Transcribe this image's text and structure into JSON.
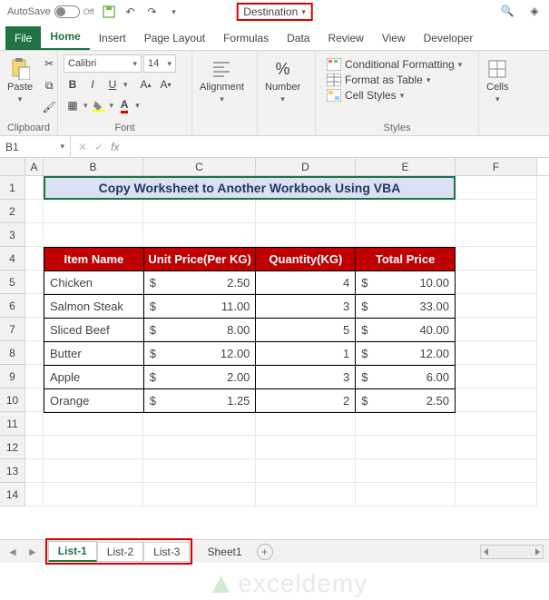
{
  "titlebar": {
    "autosave": "AutoSave",
    "toggle_state": "Off",
    "filename": "Destination"
  },
  "tabs": {
    "file": "File",
    "home": "Home",
    "insert": "Insert",
    "page_layout": "Page Layout",
    "formulas": "Formulas",
    "data": "Data",
    "review": "Review",
    "view": "View",
    "developer": "Developer"
  },
  "ribbon": {
    "clipboard": {
      "paste": "Paste",
      "label": "Clipboard"
    },
    "font": {
      "name": "Calibri",
      "size": "14",
      "label": "Font"
    },
    "alignment": {
      "label": "Alignment"
    },
    "number": {
      "label": "Number"
    },
    "styles": {
      "cond_fmt": "Conditional Formatting",
      "fmt_table": "Format as Table",
      "cell_styles": "Cell Styles",
      "label": "Styles"
    },
    "cells": {
      "label": "Cells"
    }
  },
  "namebox": "B1",
  "fx_label": "fx",
  "columns": [
    "A",
    "B",
    "C",
    "D",
    "E",
    "F"
  ],
  "rows": [
    "1",
    "2",
    "3",
    "4",
    "5",
    "6",
    "7",
    "8",
    "9",
    "10",
    "11",
    "12",
    "13",
    "14"
  ],
  "banner": "Copy Worksheet to Another Workbook Using VBA",
  "table": {
    "headers": [
      "Item Name",
      "Unit Price(Per KG)",
      "Quantity(KG)",
      "Total Price"
    ],
    "rows": [
      {
        "item": "Chicken",
        "unit": "2.50",
        "qty": "4",
        "total": "10.00"
      },
      {
        "item": "Salmon Steak",
        "unit": "11.00",
        "qty": "3",
        "total": "33.00"
      },
      {
        "item": "Sliced Beef",
        "unit": "8.00",
        "qty": "5",
        "total": "40.00"
      },
      {
        "item": "Butter",
        "unit": "12.00",
        "qty": "1",
        "total": "12.00"
      },
      {
        "item": "Apple",
        "unit": "2.00",
        "qty": "3",
        "total": "6.00"
      },
      {
        "item": "Orange",
        "unit": "1.25",
        "qty": "2",
        "total": "2.50"
      }
    ],
    "currency": "$"
  },
  "watermark": "exceldemy",
  "sheets": {
    "list1": "List-1",
    "list2": "List-2",
    "list3": "List-3",
    "sheet1": "Sheet1"
  }
}
